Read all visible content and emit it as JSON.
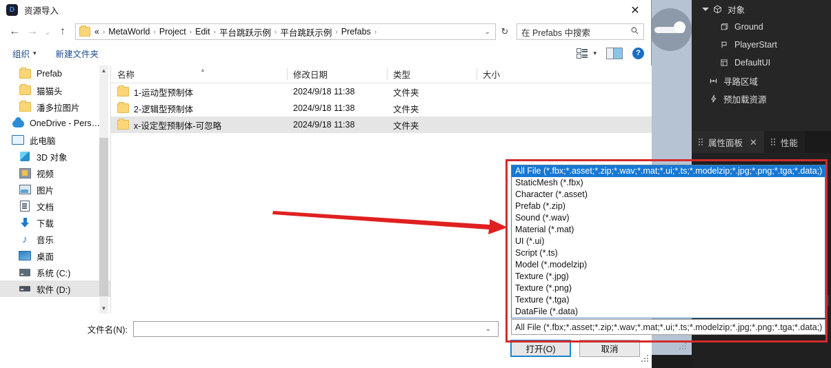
{
  "dialog": {
    "title": "资源导入",
    "app_icon": "D",
    "close_icon": "✕",
    "nav": {
      "back_icon": "←",
      "forward_icon": "→",
      "recent_icon": "⌄",
      "up_icon": "↑",
      "breadcrumb": [
        "«",
        "MetaWorld",
        "Project",
        "Edit",
        "平台跳跃示例",
        "平台跳跃示例",
        "Prefabs"
      ],
      "breadcrumb_chevron": "›",
      "dropdown_icon": "⌄",
      "refresh_icon": "↻"
    },
    "search": {
      "placeholder": "在 Prefabs 中搜索",
      "icon": "search-icon"
    },
    "commands": {
      "organize": "组织",
      "organize_caret": "▾",
      "new_folder": "新建文件夹",
      "view_caret": "▾",
      "help": "?"
    },
    "sidebar": [
      {
        "label": "Prefab",
        "icon": "folder-icon",
        "indent": 1,
        "selected": false
      },
      {
        "label": "猫猫头",
        "icon": "folder-icon",
        "indent": 1,
        "selected": false
      },
      {
        "label": "潘多拉图片",
        "icon": "folder-icon",
        "indent": 1,
        "selected": false
      },
      {
        "label": "OneDrive - Pers…",
        "icon": "onedrive-icon",
        "indent": 0,
        "selected": false
      },
      {
        "label": "此电脑",
        "icon": "this-pc-icon",
        "indent": 0,
        "selected": false
      },
      {
        "label": "3D 对象",
        "icon": "3d-objects-icon",
        "indent": 1,
        "selected": false
      },
      {
        "label": "视频",
        "icon": "videos-icon",
        "indent": 1,
        "selected": false
      },
      {
        "label": "图片",
        "icon": "pictures-icon",
        "indent": 1,
        "selected": false
      },
      {
        "label": "文档",
        "icon": "documents-icon",
        "indent": 1,
        "selected": false
      },
      {
        "label": "下载",
        "icon": "downloads-icon",
        "indent": 1,
        "selected": false
      },
      {
        "label": "音乐",
        "icon": "music-icon",
        "indent": 1,
        "selected": false
      },
      {
        "label": "桌面",
        "icon": "desktop-icon",
        "indent": 1,
        "selected": false
      },
      {
        "label": "系统 (C:)",
        "icon": "drive-icon",
        "indent": 1,
        "selected": false
      },
      {
        "label": "软件 (D:)",
        "icon": "drive-icon",
        "indent": 1,
        "selected": true
      }
    ],
    "columns": [
      "名称",
      "修改日期",
      "类型",
      "大小"
    ],
    "files": [
      {
        "name": "1-运动型预制体",
        "date": "2024/9/18 11:38",
        "type": "文件夹",
        "size": "",
        "selected": false
      },
      {
        "name": "2-逻辑型预制体",
        "date": "2024/9/18 11:38",
        "type": "文件夹",
        "size": "",
        "selected": false
      },
      {
        "name": "x-设定型预制体-可忽略",
        "date": "2024/9/18 11:38",
        "type": "文件夹",
        "size": "",
        "selected": true
      }
    ],
    "filename": {
      "label": "文件名(N):",
      "value": "",
      "caret": "⌄"
    },
    "filter": {
      "value": "All File (*.fbx;*.asset;*.zip;*.wav;*.mat;*.ui;*.ts;*.modelzip;*.jpg;*.png;*.tga;*.data;)",
      "options": [
        "All File (*.fbx;*.asset;*.zip;*.wav;*.mat;*.ui;*.ts;*.modelzip;*.jpg;*.png;*.tga;*.data;)",
        "StaticMesh (*.fbx)",
        "Character (*.asset)",
        "Prefab (*.zip)",
        "Sound (*.wav)",
        "Material (*.mat)",
        "UI (*.ui)",
        "Script (*.ts)",
        "Model (*.modelzip)",
        "Texture (*.jpg)",
        "Texture (*.png)",
        "Texture (*.tga)",
        "DataFile (*.data)"
      ],
      "selected_index": 0
    },
    "buttons": {
      "open": "打开(O)",
      "cancel": "取消"
    }
  },
  "editor": {
    "outliner": [
      {
        "label": "对象",
        "icon": "cube-icon",
        "level": 0,
        "expanded": true
      },
      {
        "label": "Ground",
        "icon": "box-icon",
        "level": 1
      },
      {
        "label": "PlayerStart",
        "icon": "flag-icon",
        "level": 1
      },
      {
        "label": "DefaultUI",
        "icon": "ui-icon",
        "level": 1
      },
      {
        "label": "寻路区域",
        "icon": "navmesh-icon",
        "level": 0
      },
      {
        "label": "预加载资源",
        "icon": "bolt-icon",
        "level": 0
      }
    ],
    "tabs": [
      {
        "label": "属性面板",
        "close": "✕",
        "active": true
      },
      {
        "label": "性能",
        "close": "",
        "active": false
      }
    ]
  },
  "annotation": {
    "rect_color": "#d32a2a",
    "arrow_color": "#e02020"
  }
}
